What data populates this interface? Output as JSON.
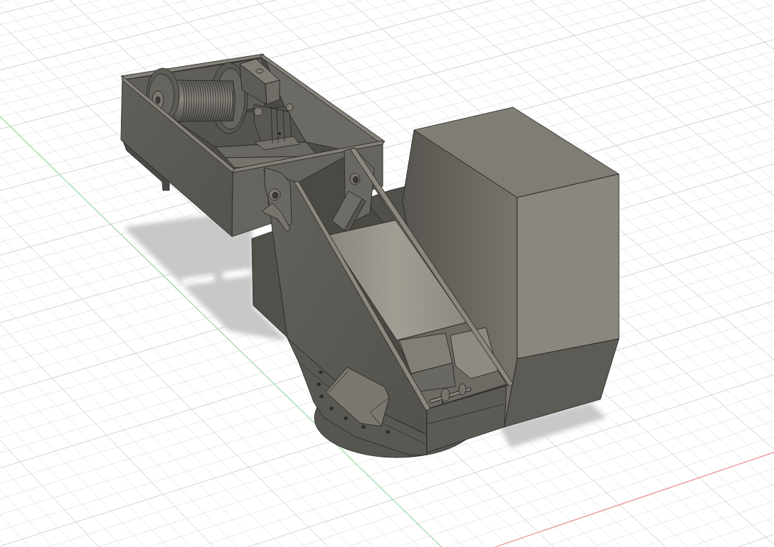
{
  "viewport": {
    "grid": true,
    "axes": true,
    "ground_shadow": true
  }
}
